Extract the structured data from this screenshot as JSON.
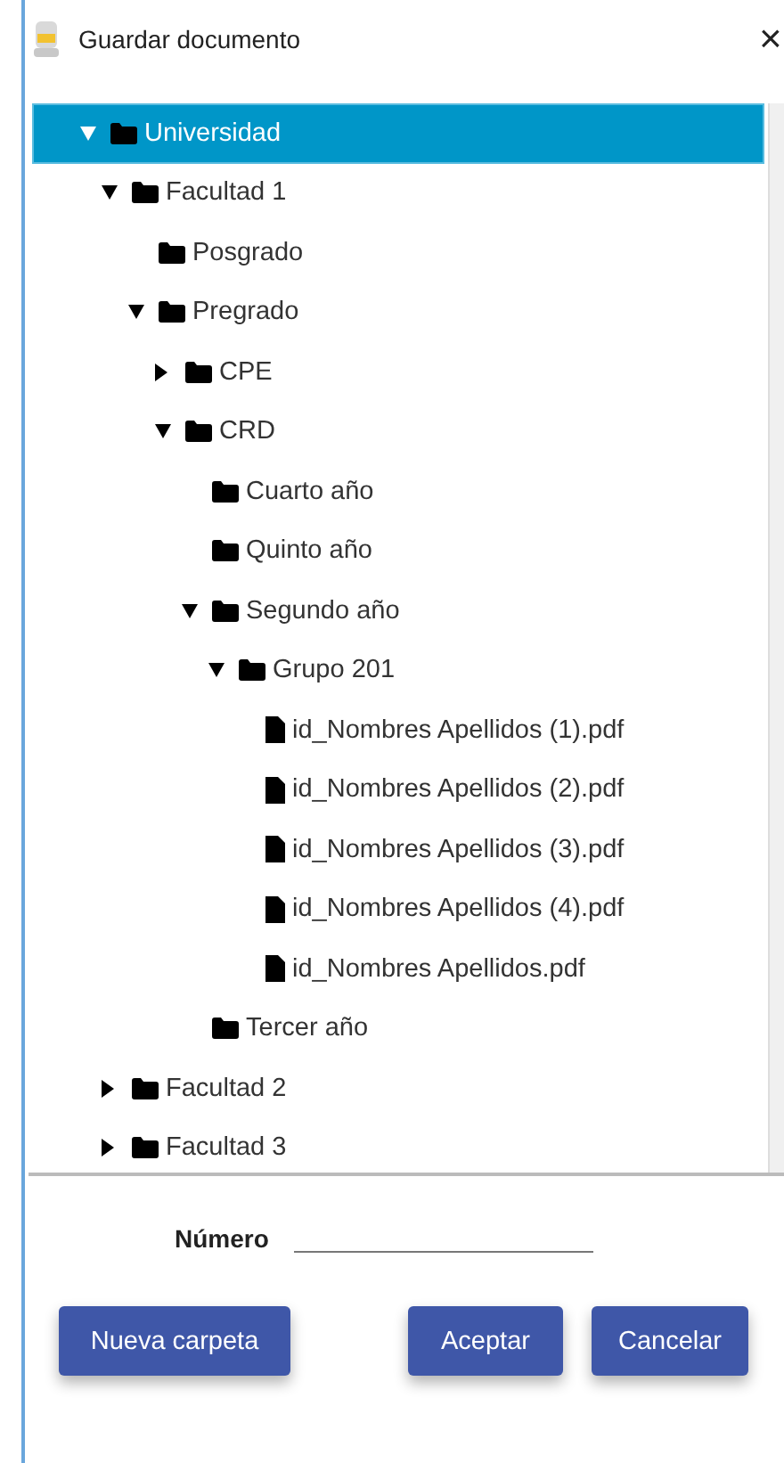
{
  "window": {
    "title": "Guardar documento",
    "close": "×"
  },
  "tree": [
    {
      "kind": "folder",
      "label": "Universidad",
      "selected": true,
      "expanded": true,
      "children": [
        {
          "kind": "folder",
          "label": "Facultad 1",
          "selected": false,
          "expanded": true,
          "children": [
            {
              "kind": "folder",
              "label": "Posgrado",
              "selected": false
            },
            {
              "kind": "folder",
              "label": "Pregrado",
              "selected": false,
              "expanded": true,
              "children": [
                {
                  "kind": "folder",
                  "label": "CPE",
                  "selected": false,
                  "expanded": false
                },
                {
                  "kind": "folder",
                  "label": "CRD",
                  "selected": false,
                  "expanded": true,
                  "children": [
                    {
                      "kind": "folder",
                      "label": "Cuarto año",
                      "selected": false
                    },
                    {
                      "kind": "folder",
                      "label": "Quinto año",
                      "selected": false
                    },
                    {
                      "kind": "folder",
                      "label": "Segundo año",
                      "selected": false,
                      "expanded": true,
                      "children": [
                        {
                          "kind": "folder",
                          "label": "Grupo 201",
                          "selected": false,
                          "expanded": true,
                          "children": [
                            {
                              "kind": "file",
                              "label": "id_Nombres Apellidos (1).pdf",
                              "selected": false
                            },
                            {
                              "kind": "file",
                              "label": "id_Nombres Apellidos (2).pdf",
                              "selected": false
                            },
                            {
                              "kind": "file",
                              "label": "id_Nombres Apellidos (3).pdf",
                              "selected": false
                            },
                            {
                              "kind": "file",
                              "label": "id_Nombres Apellidos (4).pdf",
                              "selected": false
                            },
                            {
                              "kind": "file",
                              "label": "id_Nombres Apellidos.pdf",
                              "selected": false
                            }
                          ]
                        }
                      ]
                    },
                    {
                      "kind": "folder",
                      "label": "Tercer año",
                      "selected": false
                    }
                  ]
                }
              ]
            }
          ]
        },
        {
          "kind": "folder",
          "label": "Facultad 2",
          "selected": false,
          "expanded": false
        },
        {
          "kind": "folder",
          "label": "Facultad 3",
          "selected": false,
          "expanded": false
        }
      ]
    }
  ],
  "number_field": {
    "label": "Número"
  },
  "buttons": [
    {
      "label": "Nueva carpeta"
    },
    {
      "label": "Aceptar"
    },
    {
      "label": "Cancelar"
    }
  ]
}
